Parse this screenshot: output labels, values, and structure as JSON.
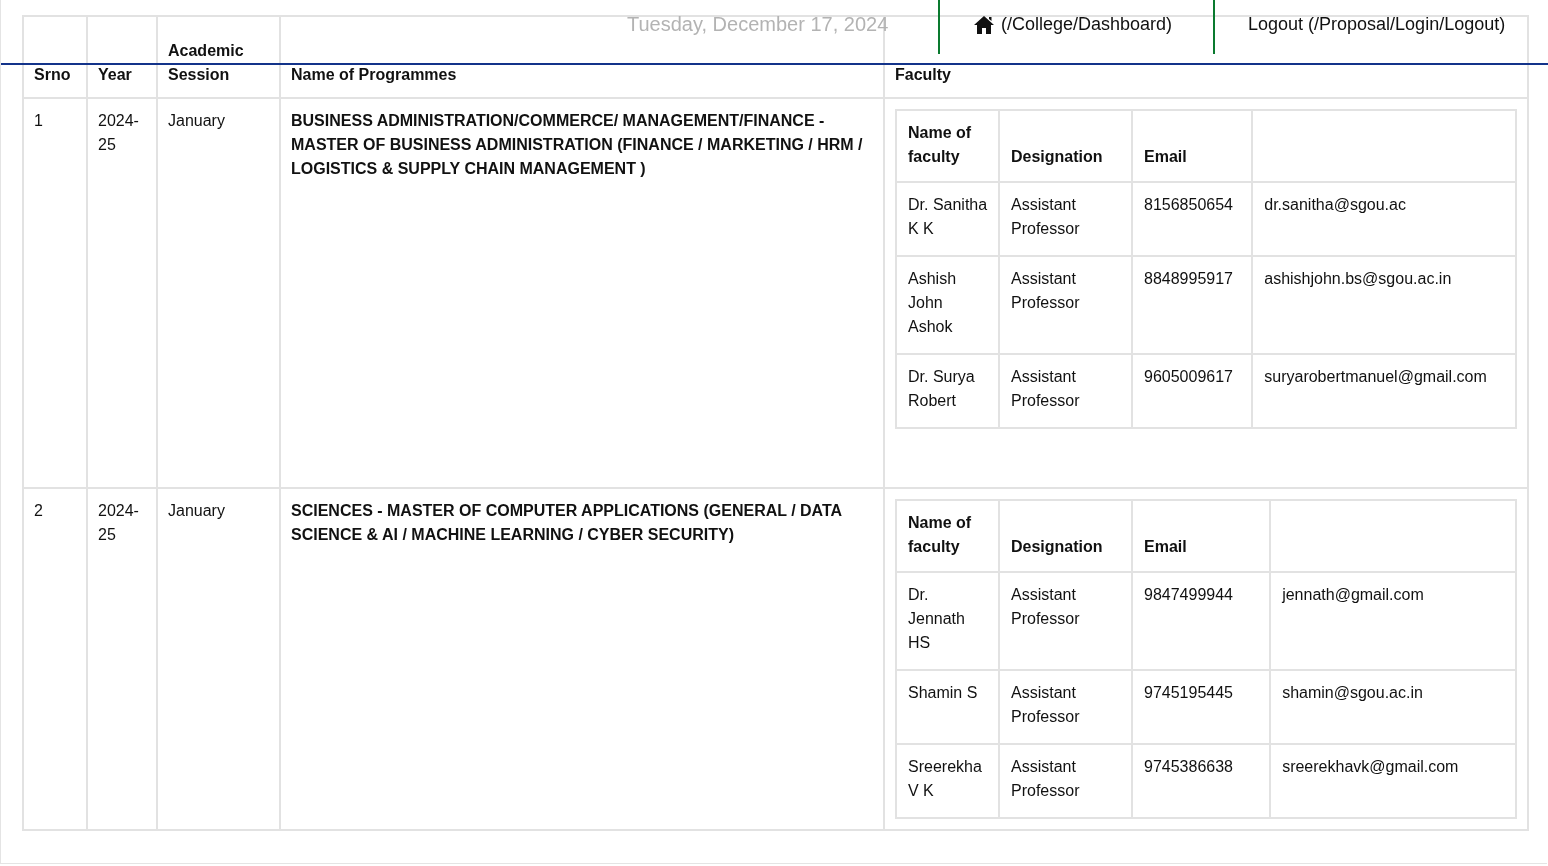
{
  "top_bar": {
    "date": "Tuesday, December 17, 2024",
    "home_link": "(/College/Dashboard)",
    "logout_link": "Logout (/Proposal/Login/Logout)"
  },
  "table": {
    "columns": [
      "Srno",
      "Year",
      "Academic Session",
      "Name of Programmes",
      "Faculty"
    ],
    "rows": [
      {
        "srno": "1",
        "year": "2024-25",
        "session": "January",
        "programme": "BUSINESS ADMINISTRATION/COMMERCE/ MANAGEMENT/FINANCE - MASTER OF BUSINESS ADMINISTRATION (FINANCE / MARKETING / HRM / LOGISTICS & SUPPLY CHAIN MANAGEMENT )",
        "faculty": {
          "columns": [
            "Name of faculty",
            "Designation",
            "Email"
          ],
          "rows": [
            {
              "name": "Dr. Sanitha K K",
              "designation": "Assistant Professor",
              "phone": "8156850654",
              "email": "dr.sanitha@sgou.ac"
            },
            {
              "name": "Ashish John Ashok",
              "designation": "Assistant Professor",
              "phone": "8848995917",
              "email": "ashishjohn.bs@sgou.ac.in"
            },
            {
              "name": "Dr. Surya Robert",
              "designation": "Assistant Professor",
              "phone": "9605009617",
              "email": "suryarobertmanuel@gmail.com"
            }
          ]
        }
      },
      {
        "srno": "2",
        "year": "2024-25",
        "session": "January",
        "programme": "SCIENCES - MASTER OF COMPUTER APPLICATIONS (GENERAL / DATA SCIENCE & AI / MACHINE LEARNING / CYBER SECURITY)",
        "faculty": {
          "columns": [
            "Name of faculty",
            "Designation",
            "Email"
          ],
          "rows": [
            {
              "name": "Dr. Jennath HS",
              "designation": "Assistant Professor",
              "phone": "9847499944",
              "email": "jennath@gmail.com"
            },
            {
              "name": "Shamin S",
              "designation": "Assistant Professor",
              "phone": "9745195445",
              "email": "shamin@sgou.ac.in"
            },
            {
              "name": "Sreerekha V K",
              "designation": "Assistant Professor",
              "phone": "9745386638",
              "email": "sreerekhavk@gmail.com"
            }
          ]
        }
      }
    ]
  }
}
